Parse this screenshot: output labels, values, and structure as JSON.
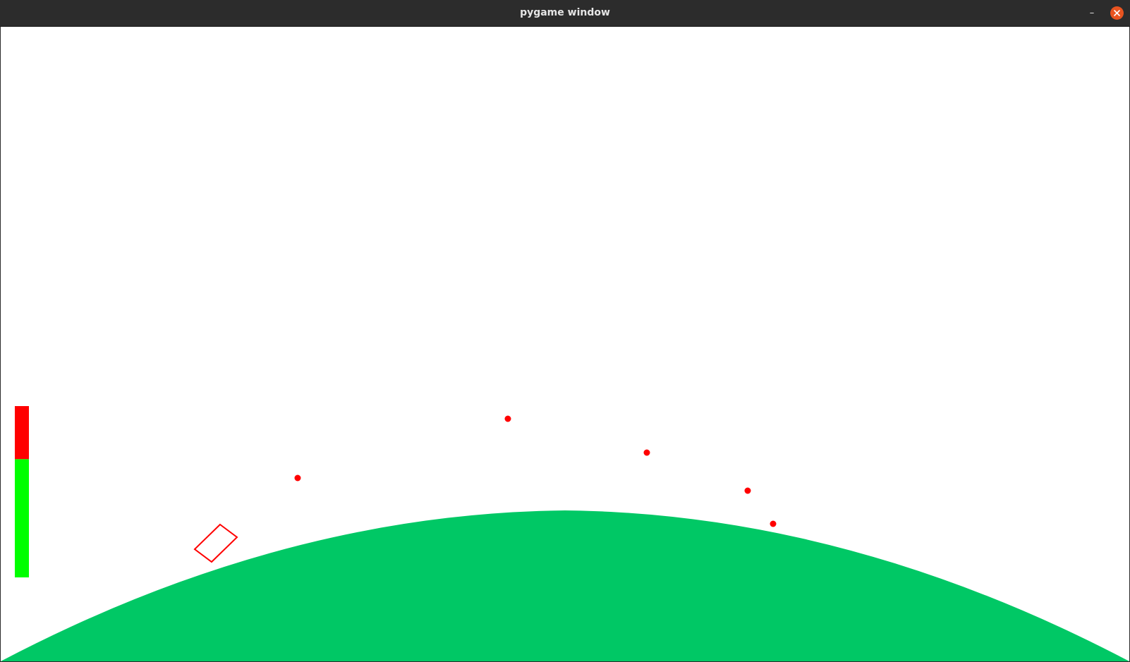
{
  "window": {
    "title": "pygame window",
    "minimize_glyph": "–",
    "close_icon": "close-icon"
  },
  "colors": {
    "titlebar": "#2c2c2c",
    "close_button": "#e95420",
    "background": "#ffffff",
    "planet": "#00c865",
    "projectile": "#ff0000",
    "lander_outline": "#ff0000",
    "fuel_used": "#ff0000",
    "fuel_remaining": "#00ff00"
  },
  "fuel_gauge": {
    "remaining_fraction": 0.69
  }
}
